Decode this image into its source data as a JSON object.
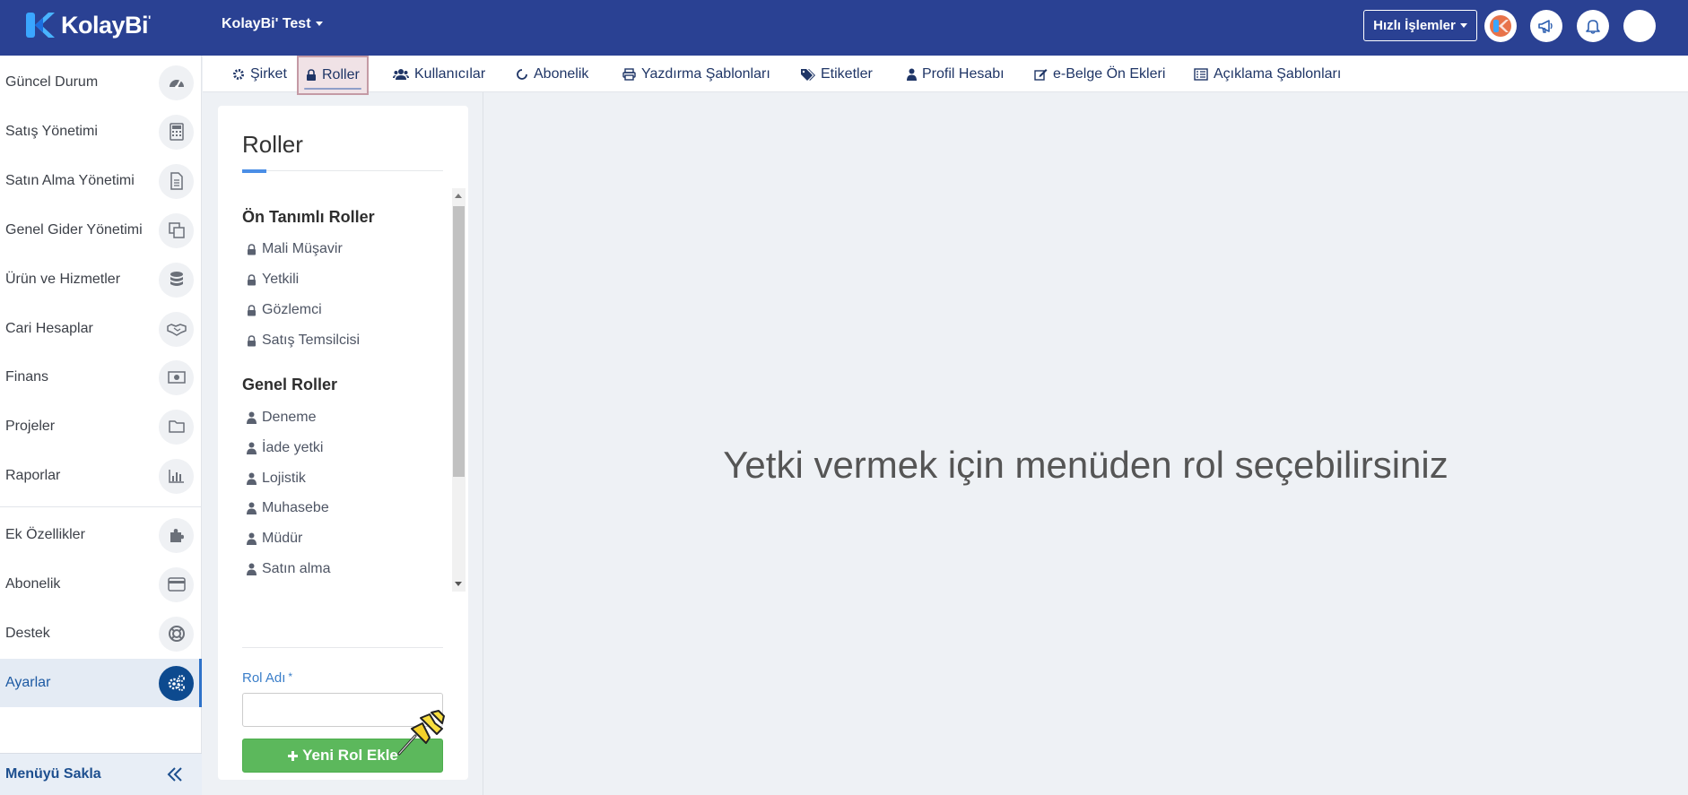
{
  "brand": {
    "name": "KolayBi",
    "mark": "'",
    "colors": {
      "topbar": "#2a4193",
      "accent": "#4a8ee6",
      "success": "#5cb85c"
    }
  },
  "topbar": {
    "company": "KolayBi' Test",
    "quick_actions": "Hızlı İşlemler",
    "icons": [
      "app-logo-icon",
      "megaphone-icon",
      "bell-icon",
      "user-avatar"
    ]
  },
  "sidebar": {
    "items": [
      {
        "label": "Güncel Durum",
        "icon": "dashboard-icon"
      },
      {
        "label": "Satış Yönetimi",
        "icon": "calculator-icon"
      },
      {
        "label": "Satın Alma Yönetimi",
        "icon": "document-icon"
      },
      {
        "label": "Genel Gider Yönetimi",
        "icon": "copy-icon"
      },
      {
        "label": "Ürün ve Hizmetler",
        "icon": "database-icon"
      },
      {
        "label": "Cari Hesaplar",
        "icon": "handshake-icon"
      },
      {
        "label": "Finans",
        "icon": "money-icon"
      },
      {
        "label": "Projeler",
        "icon": "folder-icon"
      },
      {
        "label": "Raporlar",
        "icon": "bar-chart-icon"
      },
      {
        "label": "Ek Özellikler",
        "icon": "puzzle-icon"
      },
      {
        "label": "Abonelik",
        "icon": "credit-card-icon"
      },
      {
        "label": "Destek",
        "icon": "life-ring-icon"
      },
      {
        "label": "Ayarlar",
        "icon": "gears-icon",
        "active": true
      }
    ],
    "footer": "Menüyü Sakla"
  },
  "tabs": [
    {
      "label": "Şirket",
      "icon": "gear-icon"
    },
    {
      "label": "Roller",
      "icon": "lock-icon",
      "active": true
    },
    {
      "label": "Kullanıcılar",
      "icon": "users-icon"
    },
    {
      "label": "Abonelik",
      "icon": "refresh-icon"
    },
    {
      "label": "Yazdırma Şablonları",
      "icon": "print-icon"
    },
    {
      "label": "Etiketler",
      "icon": "tags-icon"
    },
    {
      "label": "Profil Hesabı",
      "icon": "user-icon"
    },
    {
      "label": "e-Belge Ön Ekleri",
      "icon": "edit-icon"
    },
    {
      "label": "Açıklama Şablonları",
      "icon": "list-alt-icon"
    }
  ],
  "roles_panel": {
    "title": "Roller",
    "predefined_heading": "Ön Tanımlı Roller",
    "predefined": [
      "Mali Müşavir",
      "Yetkili",
      "Gözlemci",
      "Satış Temsilcisi"
    ],
    "general_heading": "Genel Roller",
    "general": [
      "Deneme",
      "İade yetki",
      "Lojistik",
      "Muhasebe",
      "Müdür",
      "Satın alma"
    ],
    "form": {
      "label": "Rol Adı",
      "required_mark": "*",
      "value": "",
      "button": "Yeni Rol Ekle"
    }
  },
  "main": {
    "message": "Yetki vermek için menüden rol seçebilirsiniz"
  }
}
